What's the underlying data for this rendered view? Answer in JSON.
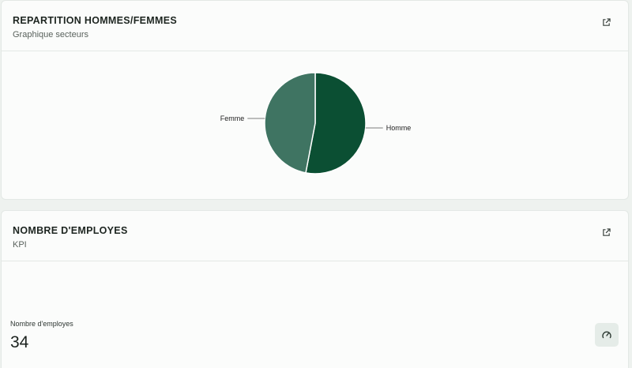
{
  "pie_card": {
    "title": "REPARTITION HOMMES/FEMMES",
    "subtitle": "Graphique secteurs"
  },
  "kpi_card": {
    "title": "NOMBRE D'EMPLOYES",
    "subtitle": "KPI",
    "label": "Nombre d'employes",
    "value": "34"
  },
  "icons": {
    "external": "external-link-icon",
    "gauge": "gauge-icon"
  },
  "colors": {
    "homme": "#0b4f33",
    "femme": "#3f7462"
  },
  "chart_data": {
    "type": "pie",
    "categories": [
      "Homme",
      "Femme"
    ],
    "values": [
      53,
      47
    ],
    "legend": "labels-outside"
  }
}
